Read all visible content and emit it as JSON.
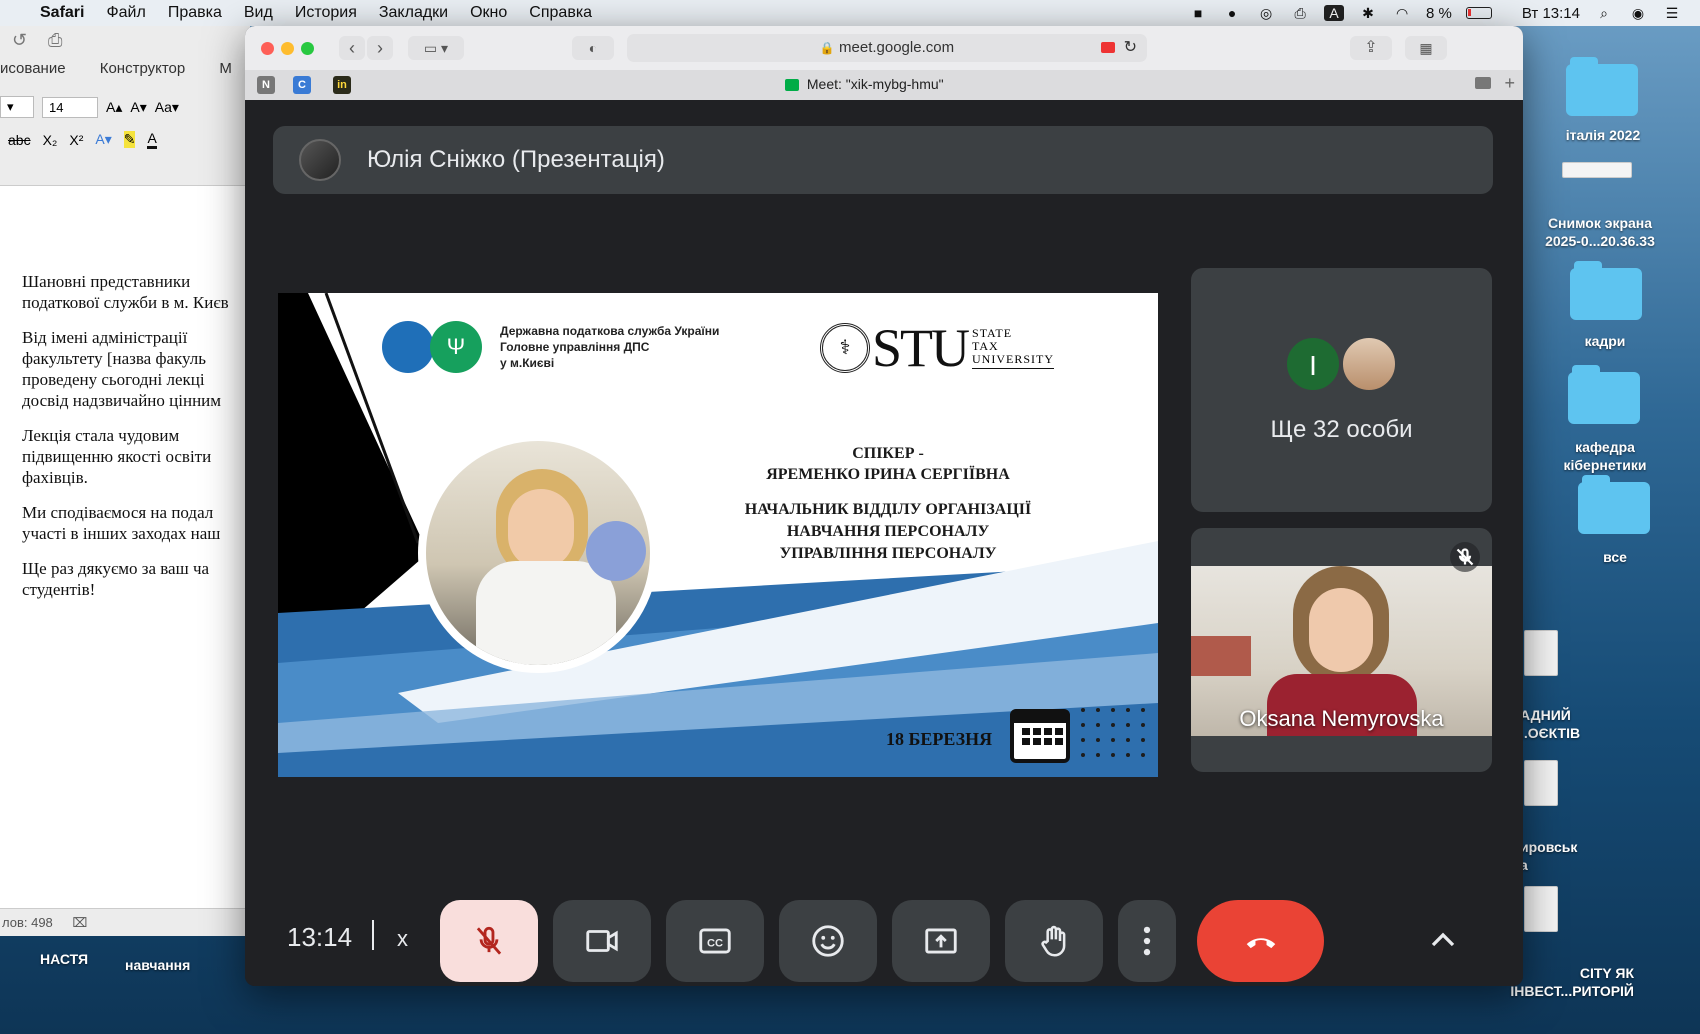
{
  "menubar": {
    "app_name": "Safari",
    "items": [
      "Файл",
      "Правка",
      "Вид",
      "История",
      "Закладки",
      "Окно",
      "Справка"
    ],
    "battery": "8 %",
    "clock": "Вт 13:14"
  },
  "word": {
    "tabs": [
      "исование",
      "Конструктор",
      "М"
    ],
    "font_size": "14",
    "paragraphs": [
      [
        "Шановні   представники",
        "податкової служби в м. Києв"
      ],
      [
        "Від   імені   адміністрації",
        "факультету [назва факуль",
        "проведену сьогодні лекці",
        "досвід  надзвичайно цінним"
      ],
      [
        "Лекція   стала   чудовим",
        "підвищенню якості освіти",
        "фахівців."
      ],
      [
        "Ми сподіваємося на подал",
        "участі в інших заходах наш"
      ],
      [
        "Ще раз дякуємо за ваш ча",
        "студентів!"
      ]
    ],
    "status": "лов: 498"
  },
  "desktop": {
    "labels": {
      "italy": "італія 2022",
      "screenshot": "Снимок экрана\n2025-0...20.36.33",
      "kadry": "кадри",
      "kafedra": "кафедра\nкібернетики",
      "vse": "все",
      "doc1": "АДНИЙ\n..ОЄКТІВ",
      "doc2": "ировськ\nа",
      "doc3": "CITY ЯК\nІНВЕСТ...РИТОРІЙ",
      "nastia": "НАСТЯ",
      "navchannia": "навчання"
    }
  },
  "safari": {
    "url": "meet.google.com",
    "tab_title": "Meet: \"xik-mybg-hmu\""
  },
  "meet": {
    "presenter": "Юлія Сніжко (Презентація)",
    "slide": {
      "org_lines": [
        "Державна податкова служба України",
        "Головне управління ДПС",
        "у м.Києві"
      ],
      "stu_logo": "STU",
      "stu_sub": [
        "STATE",
        "TAX",
        "UNIVERSITY"
      ],
      "speaker_label": "СПІКЕР -",
      "speaker_name": "ЯРЕМЕНКО ІРИНА СЕРГІЇВНА",
      "position": [
        "НАЧАЛЬНИК ВІДДІЛУ ОРГАНІЗАЦІЇ",
        "НАВЧАННЯ ПЕРСОНАЛУ",
        "УПРАВЛІННЯ ПЕРСОНАЛУ"
      ],
      "date": "18 БЕРЕЗНЯ"
    },
    "others_tile": {
      "initial": "I",
      "more": "Ще 32 особи"
    },
    "participant_tile": {
      "name": "Oksana Nemyrovska"
    },
    "controls": {
      "time": "13:14",
      "code": "x"
    }
  },
  "colors": {
    "hangup": "#ea4335",
    "mic_off_bg": "#f9dedc",
    "meet_bg": "#202124",
    "tile_bg": "#3c4043",
    "slide_blue": "#2f7ec1"
  }
}
